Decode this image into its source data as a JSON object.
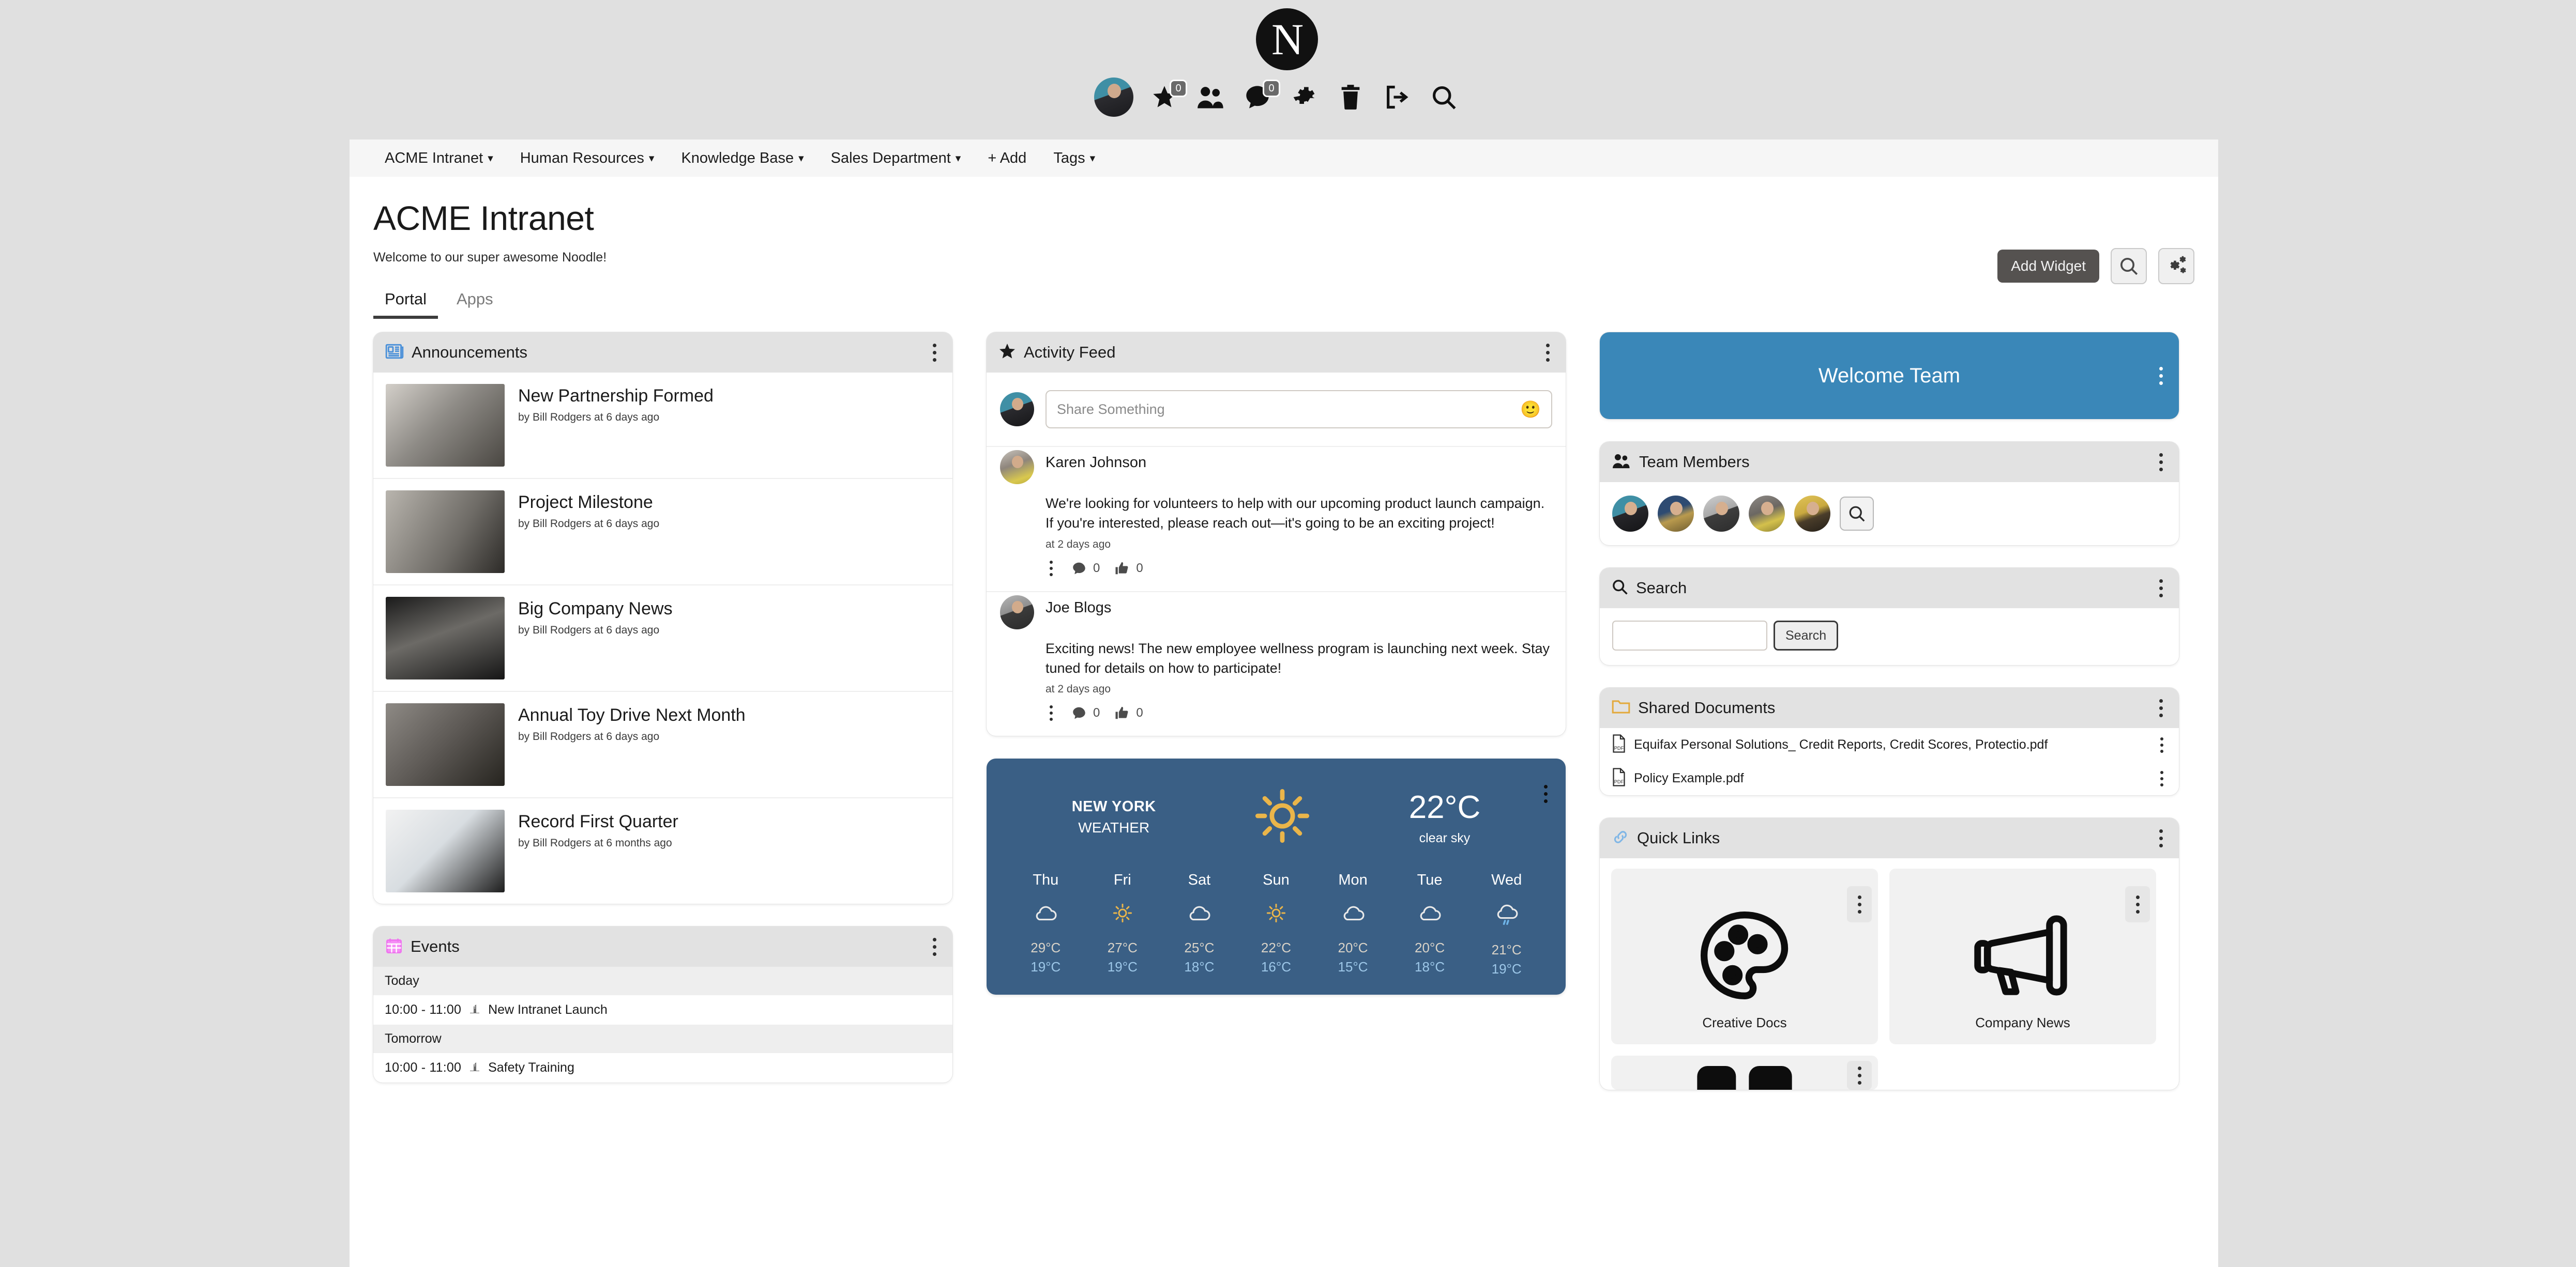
{
  "header": {
    "logo_letter": "N",
    "icons": [
      {
        "name": "user-avatar",
        "label": "Profile"
      },
      {
        "name": "star-icon",
        "label": "Favourites",
        "badge": "0"
      },
      {
        "name": "people-icon",
        "label": "People"
      },
      {
        "name": "chat-icon",
        "label": "Messages",
        "badge": "0"
      },
      {
        "name": "gear-icon",
        "label": "Settings"
      },
      {
        "name": "trash-icon",
        "label": "Recycle Bin"
      },
      {
        "name": "logout-icon",
        "label": "Log out"
      },
      {
        "name": "search-icon",
        "label": "Search"
      }
    ]
  },
  "navbar": {
    "items": [
      {
        "label": "ACME Intranet",
        "caret": true
      },
      {
        "label": "Human Resources",
        "caret": true
      },
      {
        "label": "Knowledge Base",
        "caret": true
      },
      {
        "label": "Sales Department",
        "caret": true
      },
      {
        "label": "+ Add",
        "caret": false
      },
      {
        "label": "Tags",
        "caret": true
      }
    ]
  },
  "page": {
    "title": "ACME Intranet",
    "subtitle": "Welcome to our super awesome Noodle!",
    "tabs": [
      {
        "label": "Portal",
        "active": true
      },
      {
        "label": "Apps",
        "active": false
      }
    ],
    "add_widget_label": "Add Widget"
  },
  "announcements": {
    "title": "Announcements",
    "items": [
      {
        "title": "New Partnership Formed",
        "meta": "by Bill Rodgers at 6 days ago"
      },
      {
        "title": "Project Milestone",
        "meta": "by Bill Rodgers at 6 days ago"
      },
      {
        "title": "Big Company News",
        "meta": "by Bill Rodgers at 6 days ago"
      },
      {
        "title": "Annual Toy Drive Next Month",
        "meta": "by Bill Rodgers at 6 days ago"
      },
      {
        "title": "Record First Quarter",
        "meta": "by Bill Rodgers at 6 months ago"
      }
    ]
  },
  "events": {
    "title": "Events",
    "rows": [
      {
        "type": "group",
        "label": "Today"
      },
      {
        "type": "event",
        "time": "10:00 - 11:00",
        "label": "New Intranet Launch"
      },
      {
        "type": "group",
        "label": "Tomorrow"
      },
      {
        "type": "event",
        "time": "10:00 - 11:00",
        "label": "Safety Training"
      }
    ]
  },
  "activity_feed": {
    "title": "Activity Feed",
    "share_placeholder": "Share Something",
    "share_value": "",
    "posts": [
      {
        "author": "Karen Johnson",
        "text": "We're looking for volunteers to help with our upcoming product launch campaign. If you're interested, please reach out—it's going to be an exciting project!",
        "time": "at 2 days ago",
        "comments": "0",
        "likes": "0"
      },
      {
        "author": "Joe Blogs",
        "text": "Exciting news! The new employee wellness program is launching next week. Stay tuned for details on how to participate!",
        "time": "at 2 days ago",
        "comments": "0",
        "likes": "0"
      }
    ]
  },
  "weather": {
    "city": "NEW YORK",
    "city_sub": "WEATHER",
    "temp": "22°C",
    "desc": "clear sky",
    "current_icon": "sun-icon",
    "accent_color": "#3a5f85",
    "forecast": [
      {
        "day": "Thu",
        "icon": "cloud-icon",
        "high": "29°C",
        "low": "19°C"
      },
      {
        "day": "Fri",
        "icon": "sun-icon",
        "high": "27°C",
        "low": "19°C"
      },
      {
        "day": "Sat",
        "icon": "cloud-icon",
        "high": "25°C",
        "low": "18°C"
      },
      {
        "day": "Sun",
        "icon": "sun-icon",
        "high": "22°C",
        "low": "16°C"
      },
      {
        "day": "Mon",
        "icon": "cloud-icon",
        "high": "20°C",
        "low": "15°C"
      },
      {
        "day": "Tue",
        "icon": "cloud-icon",
        "high": "20°C",
        "low": "18°C"
      },
      {
        "day": "Wed",
        "icon": "rain-icon",
        "high": "21°C",
        "low": "19°C"
      }
    ]
  },
  "welcome_team": {
    "label": "Welcome Team",
    "background": "#3a87b8"
  },
  "team_members": {
    "title": "Team Members",
    "count": 5
  },
  "search_widget": {
    "title": "Search",
    "input_value": "",
    "button_label": "Search"
  },
  "shared_documents": {
    "title": "Shared Documents",
    "files": [
      {
        "name": "Equifax Personal Solutions_ Credit Reports, Credit Scores, Protectio.pdf",
        "type": "PDF"
      },
      {
        "name": "Policy Example.pdf",
        "type": "PDF"
      }
    ]
  },
  "quick_links": {
    "title": "Quick Links",
    "tiles": [
      {
        "label": "Creative Docs",
        "icon": "palette-icon"
      },
      {
        "label": "Company News",
        "icon": "megaphone-icon"
      }
    ]
  }
}
